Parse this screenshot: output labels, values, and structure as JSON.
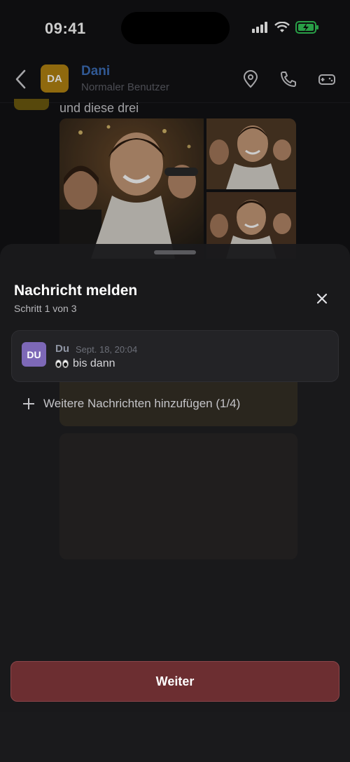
{
  "status_bar": {
    "time": "09:41"
  },
  "header": {
    "avatar_initials": "DA",
    "name": "Dani",
    "subtitle": "Normaler Benutzer",
    "icons": [
      "back-chevron-icon",
      "location-pin-icon",
      "phone-icon",
      "gamepad-icon"
    ]
  },
  "chat": {
    "previous_text": "und diese drei"
  },
  "sheet": {
    "title": "Nachricht melden",
    "step": "Schritt 1 von 3",
    "message": {
      "avatar_initials": "DU",
      "author": "Du",
      "timestamp": "Sept. 18, 20:04",
      "text": "bis dann"
    },
    "add_more_label": "Weitere Nachrichten hinzufügen (1/4)",
    "continue_label": "Weiter"
  },
  "colors": {
    "accent_name": "#3d6fb8",
    "avatar_da": "#b38412",
    "avatar_du": "#7d68b7",
    "continue_button": "#6c2e31"
  }
}
